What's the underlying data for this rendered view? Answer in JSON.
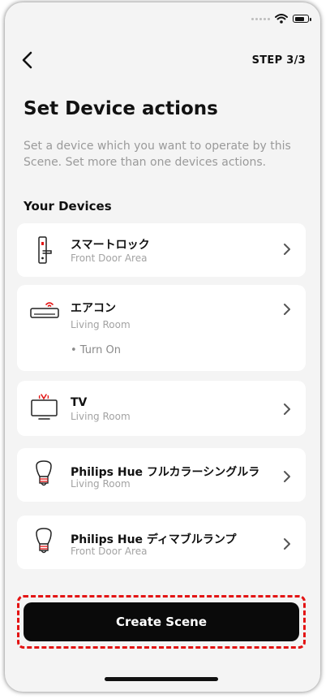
{
  "header": {
    "step": "STEP 3/3"
  },
  "page": {
    "title": "Set Device actions",
    "description": "Set a device which you want to operate by this Scene. Set more than one devices actions.",
    "section_label": "Your Devices"
  },
  "devices": [
    {
      "name": "スマートロック",
      "location": "Front Door Area",
      "icon": "smart-lock-icon"
    },
    {
      "name": "エアコン",
      "location": "Living Room",
      "action": "• Turn On",
      "icon": "air-conditioner-icon"
    },
    {
      "name": "TV",
      "location": "Living Room",
      "icon": "tv-icon"
    },
    {
      "name": "Philips Hue フルカラーシングルラ",
      "location": "Living Room",
      "icon": "bulb-icon"
    },
    {
      "name": "Philips Hue ディマブルランプ",
      "location": "Front Door Area",
      "icon": "bulb-icon"
    }
  ],
  "footer": {
    "cta_label": "Create Scene"
  },
  "colors": {
    "accent": "#e31313",
    "button": "#0a0a0a",
    "background": "#f4f4f4"
  }
}
